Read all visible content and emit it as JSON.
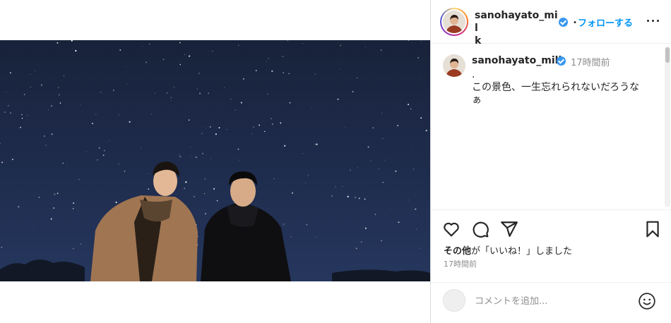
{
  "post": {
    "username": "sanohayato_milk",
    "username_line1": "sanohayato_mil",
    "username_line2": "k",
    "verified": true,
    "dot_separator": "・",
    "follow_label": "フォローする",
    "more_icon": "more-horizontal-icon"
  },
  "caption": {
    "username": "sanohayato_milk",
    "time": "17時間前",
    "lines": [
      ".",
      "この景色、一生忘れられないだろうな",
      "ぁ"
    ]
  },
  "actions": {
    "icons": [
      "heart-icon",
      "comment-icon",
      "share-icon",
      "bookmark-icon"
    ],
    "likes_bold": "その他",
    "likes_text": "が「いいね！」しました",
    "timestamp": "17時間前"
  },
  "comment_box": {
    "placeholder": "コメントを追加...",
    "emoji_icon": "smiley-icon"
  },
  "colors": {
    "accent": "#0095f6",
    "verified": "#3897f0",
    "text": "#262626",
    "muted": "#8e8e8e",
    "sky": "#1c2742"
  }
}
